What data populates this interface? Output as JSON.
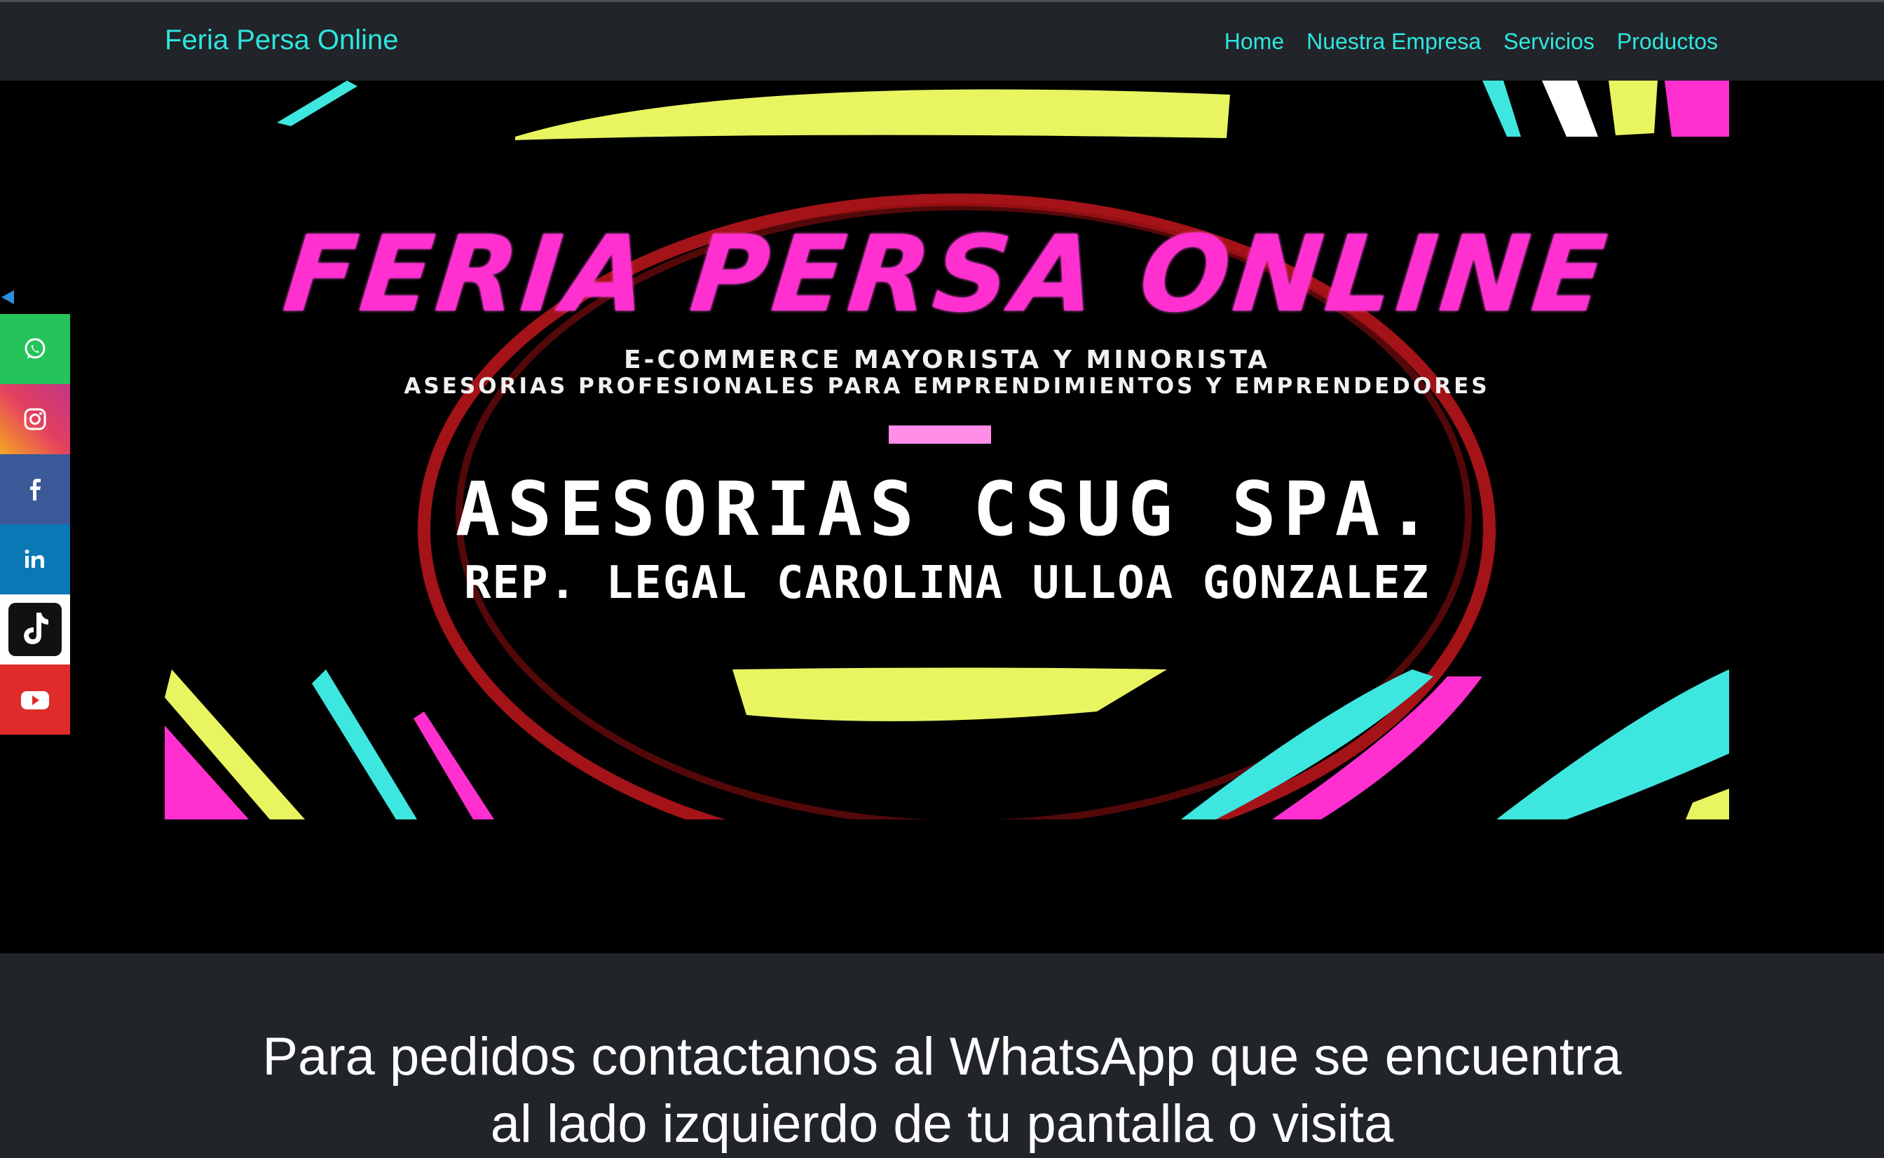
{
  "navbar": {
    "brand": "Feria Persa Online",
    "links": [
      "Home",
      "Nuestra Empresa",
      "Servicios",
      "Productos"
    ]
  },
  "banner": {
    "title": "FERIA PERSA ONLINE",
    "subtitle1": "E-COMMERCE MAYORISTA Y MINORISTA",
    "subtitle2": "ASESORIAS PROFESIONALES PARA EMPRENDIMIENTOS Y EMPRENDEDORES",
    "company": "ASESORIAS CSUG SPA.",
    "representative": "REP. LEGAL CAROLINA  ULLOA  GONZALEZ"
  },
  "content": {
    "text": "Para pedidos contactanos al WhatsApp que se encuentra al lado izquierdo de tu pantalla o visita"
  },
  "social": {
    "items": [
      "whatsapp-icon",
      "instagram-icon",
      "facebook-icon",
      "linkedin-icon",
      "tiktok-icon",
      "youtube-icon"
    ],
    "colors": {
      "whatsapp": "#25c45a",
      "facebook": "#3b5998",
      "linkedin": "#0a78b5",
      "tiktok": "#ffffff",
      "youtube": "#e02b2b"
    }
  },
  "theme": {
    "accent": "#2ee6df",
    "navbar_bg": "#212429",
    "banner_pink": "#ff2fd0"
  }
}
